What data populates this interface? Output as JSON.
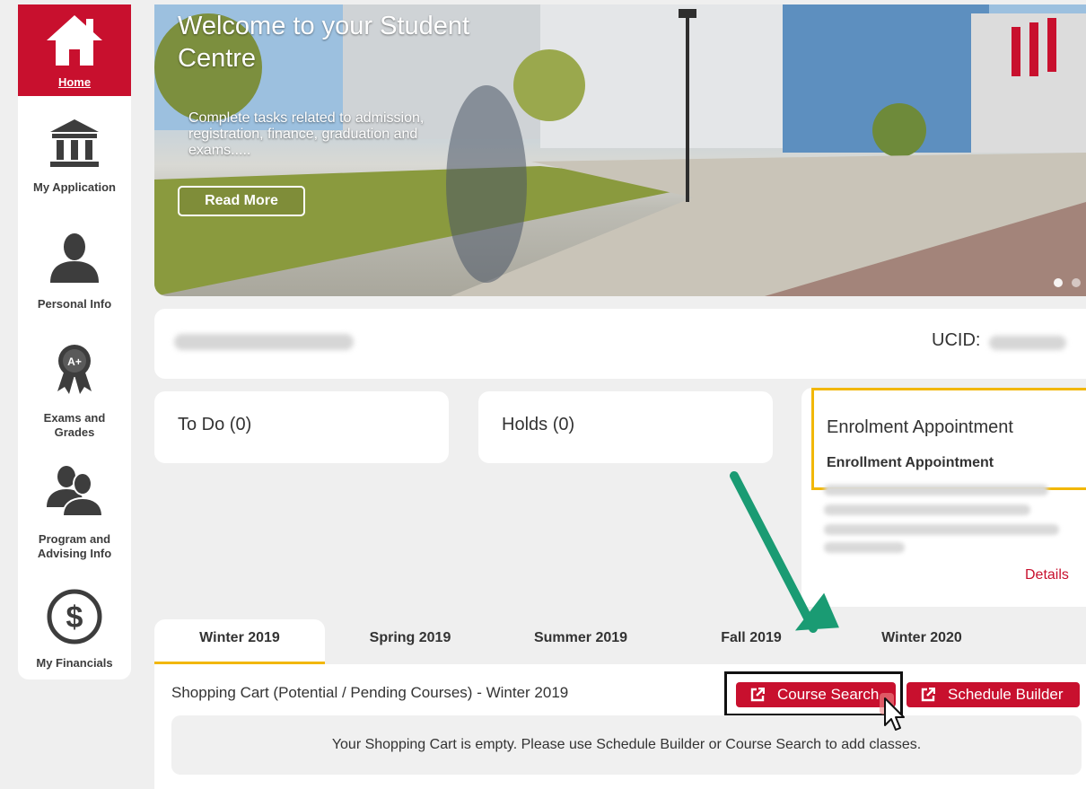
{
  "sidebar": {
    "items": [
      {
        "label": "Home",
        "icon": "home-icon"
      },
      {
        "label": "My Application",
        "icon": "institution-icon"
      },
      {
        "label": "Personal Info",
        "icon": "person-icon"
      },
      {
        "label": "Exams and\nGrades",
        "icon": "award-ribbon-icon"
      },
      {
        "label": "Program and\nAdvising Info",
        "icon": "people-icon"
      },
      {
        "label": "My Financials",
        "icon": "dollar-circle-icon"
      }
    ]
  },
  "hero": {
    "title": "Welcome to your Student Centre",
    "subtitle": "Complete tasks related to admission, registration, finance, graduation and exams.....",
    "button_label": "Read More"
  },
  "student": {
    "ucid_label": "UCID:"
  },
  "cards": {
    "todo": "To Do (0)",
    "holds": "Holds (0)",
    "appointment_title": "Enrolment Appointment",
    "appointment_subtitle": "Enrollment Appointment",
    "details_link": "Details"
  },
  "tabs": [
    "Winter 2019",
    "Spring 2019",
    "Summer 2019",
    "Fall 2019",
    "Winter 2020"
  ],
  "active_tab": "Winter 2019",
  "cart": {
    "title": "Shopping Cart (Potential / Pending Courses) - Winter 2019",
    "course_search_label": "Course Search",
    "schedule_builder_label": "Schedule Builder",
    "empty_message": "Your Shopping Cart is empty. Please use Schedule Builder or Course Search to add classes."
  },
  "colors": {
    "brand_red": "#c8102e",
    "accent_yellow": "#f2b705",
    "annotation_arrow": "#1a9b73"
  }
}
